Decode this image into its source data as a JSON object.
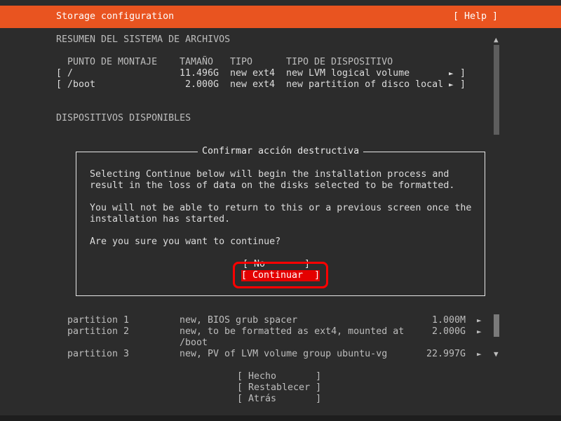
{
  "header": {
    "title": "Storage configuration",
    "help": "[ Help ]"
  },
  "summary": {
    "heading": "RESUMEN DEL SISTEMA DE ARCHIVOS",
    "columns": [
      "PUNTO DE MONTAJE",
      "TAMAÑO",
      "TIPO",
      "TIPO DE DISPOSITIVO"
    ],
    "rows": [
      {
        "open": "[",
        "mount": "/",
        "size": "11.496G",
        "type": "new ext4",
        "device": "new LVM logical volume",
        "arrow": "►",
        "close": "]"
      },
      {
        "open": "[",
        "mount": "/boot",
        "size": "2.000G",
        "type": "new ext4",
        "device": "new partition of disco local",
        "arrow": "►",
        "close": "]"
      }
    ]
  },
  "available": {
    "heading": "DISPOSITIVOS DISPONIBLES"
  },
  "dialog": {
    "title": "Confirmar acción destructiva",
    "line1": "Selecting Continue below will begin the installation process and",
    "line2": "result in the loss of data on the disks selected to be formatted.",
    "line3": "You will not be able to return to this or a previous screen once the",
    "line4": "installation has started.",
    "question": "Are you sure you want to continue?",
    "no_button": "[ No       ]",
    "continue_button": "[ Continuar  ]"
  },
  "partitions": [
    {
      "name": "partition 1",
      "desc": "new, BIOS grub spacer",
      "desc2": "",
      "size": "1.000M",
      "arrow": "►"
    },
    {
      "name": "partition 2",
      "desc": "new, to be formatted as ext4, mounted at",
      "desc2": "/boot",
      "size": "2.000G",
      "arrow": "►"
    },
    {
      "name": "partition 3",
      "desc": "new, PV of LVM volume group ubuntu-vg",
      "desc2": "",
      "size": "22.997G",
      "arrow": "►"
    }
  ],
  "footer_buttons": {
    "done": "[ Hecho       ]",
    "reset": "[ Restablecer ]",
    "back": "[ Atrás       ]"
  },
  "scroll": {
    "up": "▲",
    "down": "▼"
  },
  "colors": {
    "accent": "#e95420",
    "background": "#2c2c2c",
    "selected": "#e40000",
    "highlight": "#ff0000"
  }
}
